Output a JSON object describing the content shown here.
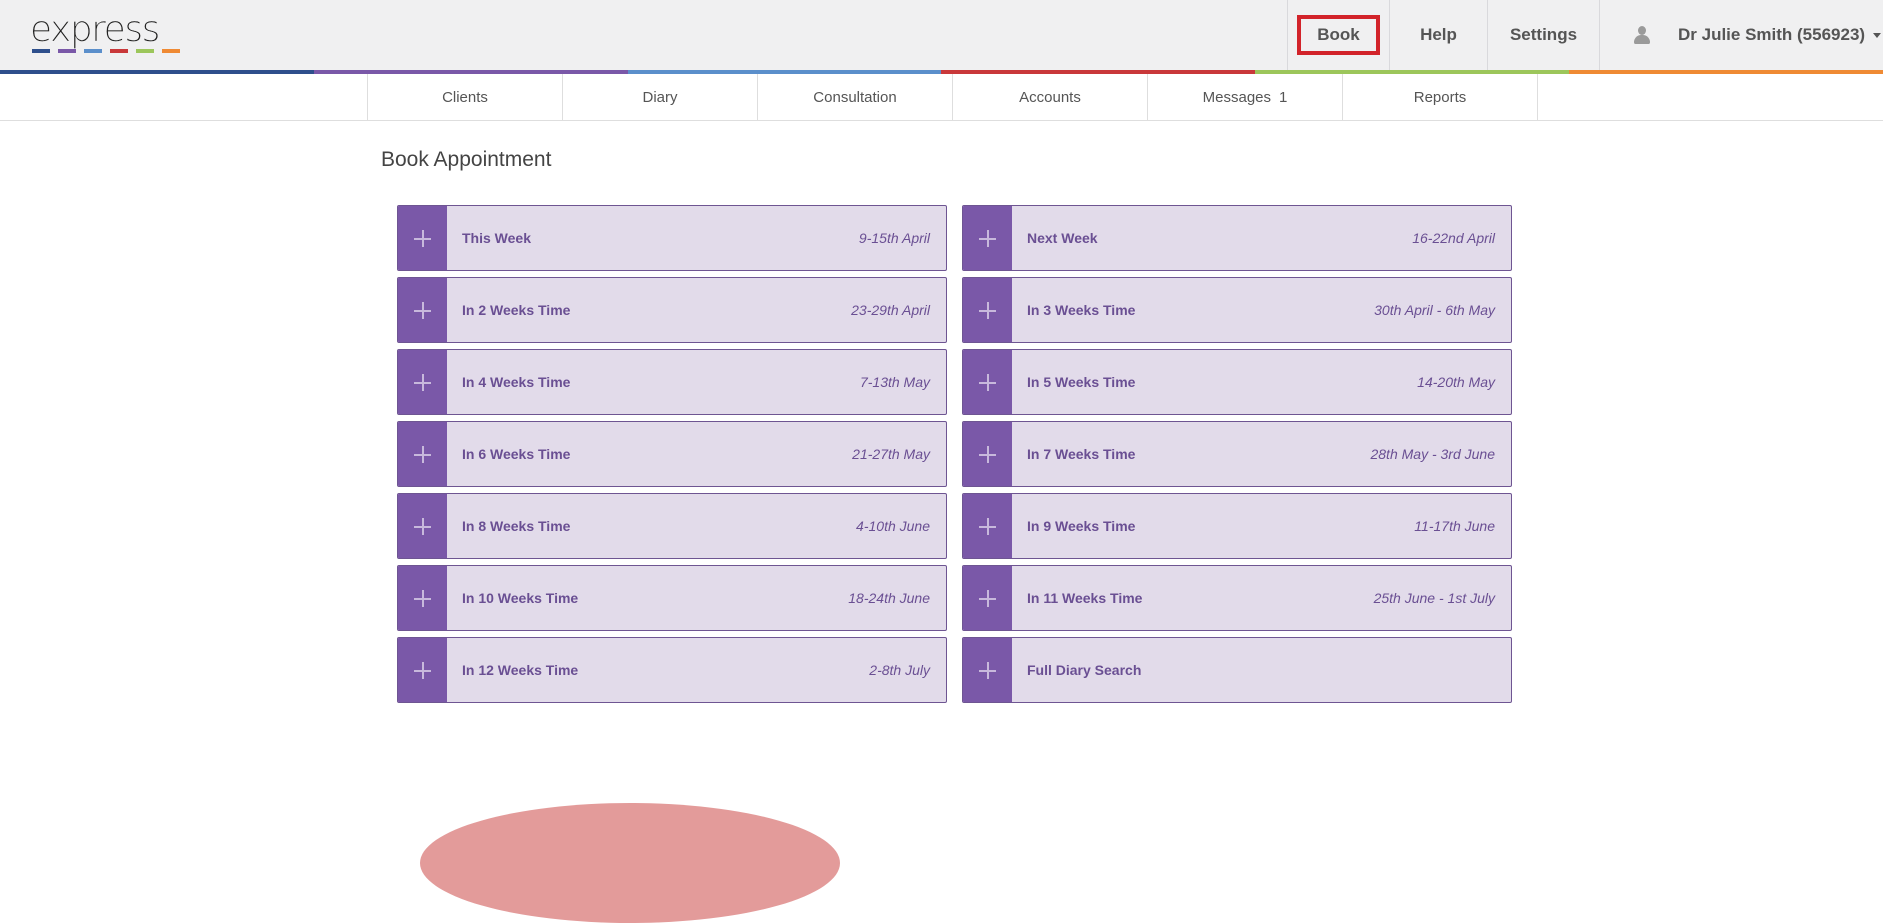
{
  "app": {
    "logo_text": "express",
    "logo_colors": [
      "#2e4f8c",
      "#7a58a8",
      "#5b8fcb",
      "#c9383a",
      "#9cc65b",
      "#ef8a34"
    ]
  },
  "header": {
    "book_label": "Book",
    "help_label": "Help",
    "settings_label": "Settings",
    "user_name": "Dr Julie Smith (556923)"
  },
  "strip_colors": [
    "#2e4f8c",
    "#7a58a8",
    "#5b8fcb",
    "#c9383a",
    "#9cc65b",
    "#ef8a34"
  ],
  "subnav": {
    "tabs": [
      {
        "label": "Clients"
      },
      {
        "label": "Diary"
      },
      {
        "label": "Consultation"
      },
      {
        "label": "Accounts"
      },
      {
        "label": "Messages",
        "count": "1"
      },
      {
        "label": "Reports"
      }
    ]
  },
  "page": {
    "title": "Book Appointment"
  },
  "appointments": [
    {
      "label": "This Week",
      "range": "9-15th April"
    },
    {
      "label": "Next Week",
      "range": "16-22nd April"
    },
    {
      "label": "In 2 Weeks Time",
      "range": "23-29th April"
    },
    {
      "label": "In 3 Weeks Time",
      "range": "30th April - 6th May"
    },
    {
      "label": "In 4 Weeks Time",
      "range": "7-13th May"
    },
    {
      "label": "In 5 Weeks Time",
      "range": "14-20th May"
    },
    {
      "label": "In 6 Weeks Time",
      "range": "21-27th May"
    },
    {
      "label": "In 7 Weeks Time",
      "range": "28th May - 3rd June"
    },
    {
      "label": "In 8 Weeks Time",
      "range": "4-10th June"
    },
    {
      "label": "In 9 Weeks Time",
      "range": "11-17th June"
    },
    {
      "label": "In 10 Weeks Time",
      "range": "18-24th June"
    },
    {
      "label": "In 11 Weeks Time",
      "range": "25th June - 1st July"
    },
    {
      "label": "In 12 Weeks Time",
      "range": "2-8th July"
    },
    {
      "label": "Full Diary Search",
      "range": ""
    }
  ]
}
